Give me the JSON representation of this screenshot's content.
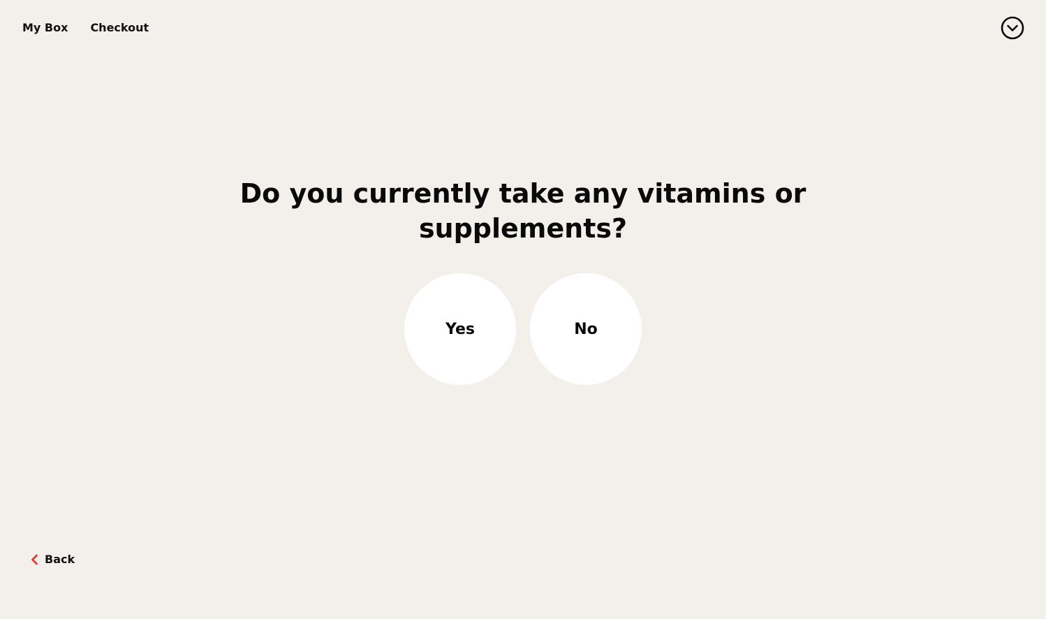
{
  "nav": {
    "items": [
      {
        "label": "My Box"
      },
      {
        "label": "Checkout"
      }
    ]
  },
  "menu_toggle": {
    "icon": "chevron-down-circle-icon"
  },
  "question": {
    "line1": "Do you currently take any vitamins or",
    "line2": "supplements?"
  },
  "answers": [
    {
      "label": "Yes"
    },
    {
      "label": "No"
    }
  ],
  "back": {
    "label": "Back",
    "icon": "chevron-left-icon",
    "icon_color": "#e03c31"
  },
  "colors": {
    "background": "#f3efeb",
    "option_fill": "#ffffff",
    "text": "#0a0a0a",
    "accent": "#e03c31"
  }
}
